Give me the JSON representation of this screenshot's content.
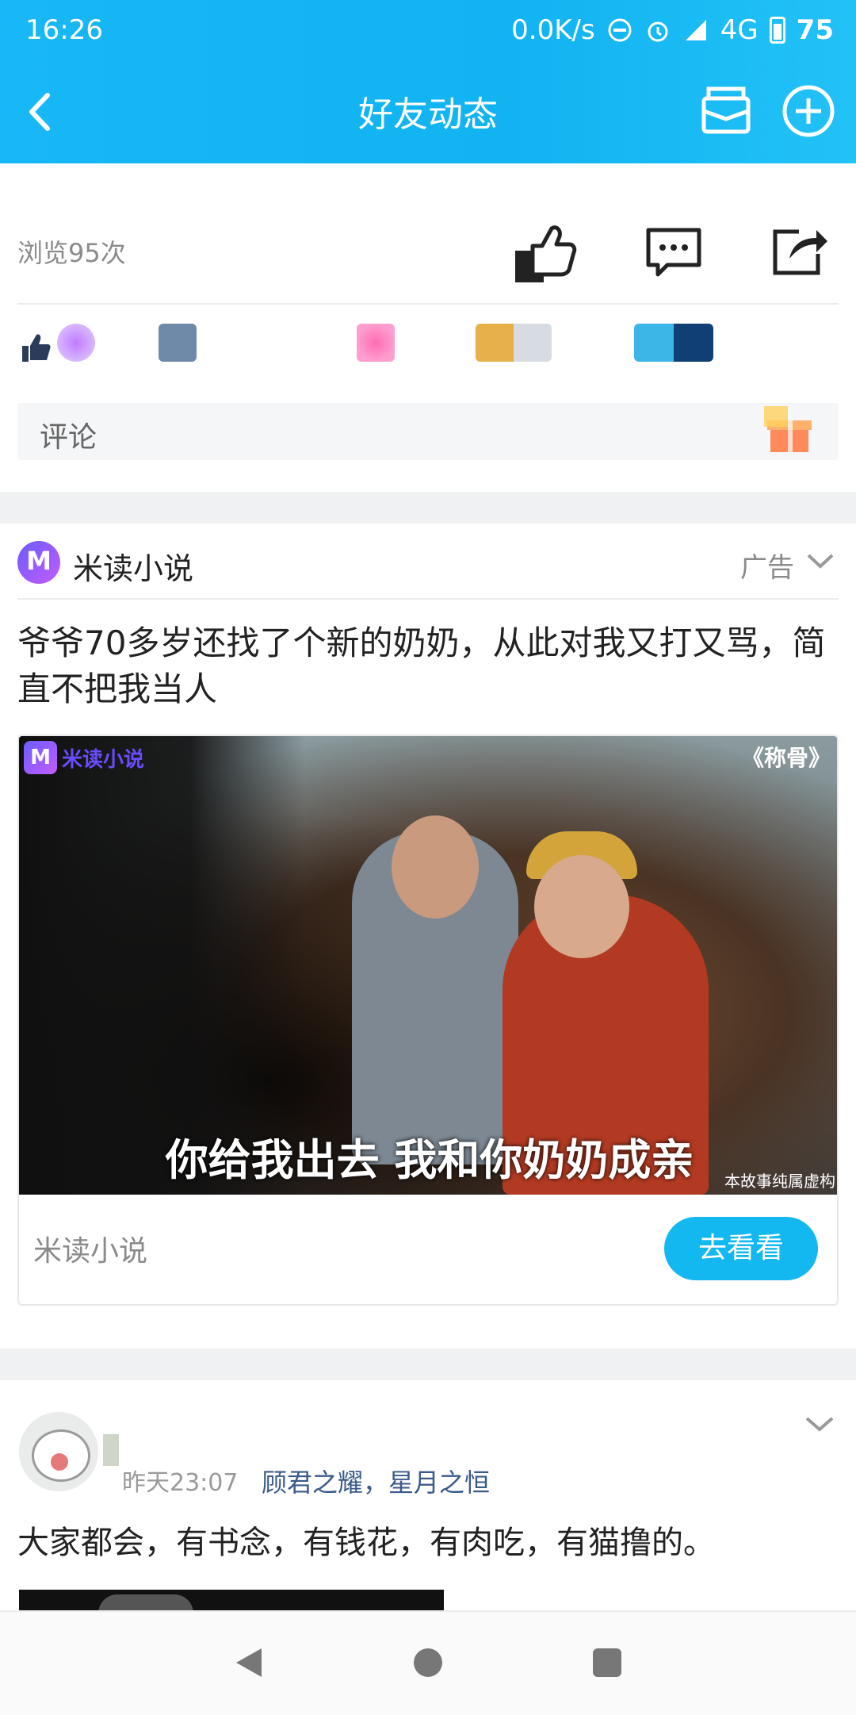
{
  "status_bar": {
    "time": "16:26",
    "net_speed": "0.0K/s",
    "network": "4G",
    "battery": "75"
  },
  "header": {
    "title": "好友动态"
  },
  "feed_stats": {
    "views": "浏览95次",
    "comment_placeholder": "评论"
  },
  "ad_post": {
    "advertiser": "米读小说",
    "ad_label": "广告",
    "headline": "爷爷70多岁还找了个新的奶奶，从此对我又打又骂，简直不把我当人",
    "image": {
      "brand_text": "米读小说",
      "book_title": "《称骨》",
      "subtitle": "你给我出去  我和你奶奶成亲",
      "disclaimer": "本故事纯属虚构"
    },
    "source": "米读小说",
    "cta": "去看看"
  },
  "friend_post": {
    "time": "昨天23:07",
    "tagged": "顾君之耀，星月之恒",
    "text": "大家都会，有书念，有钱花，有肉吃，有猫撸的。"
  },
  "colors": {
    "primary": "#13b8f1",
    "link": "#3a5a8a"
  },
  "icons": [
    "back-icon",
    "mail-icon",
    "add-icon",
    "like-icon",
    "comment-icon",
    "share-icon",
    "gift-icon",
    "chevron-down-icon",
    "nav-back-icon",
    "nav-home-icon",
    "nav-recent-icon"
  ]
}
